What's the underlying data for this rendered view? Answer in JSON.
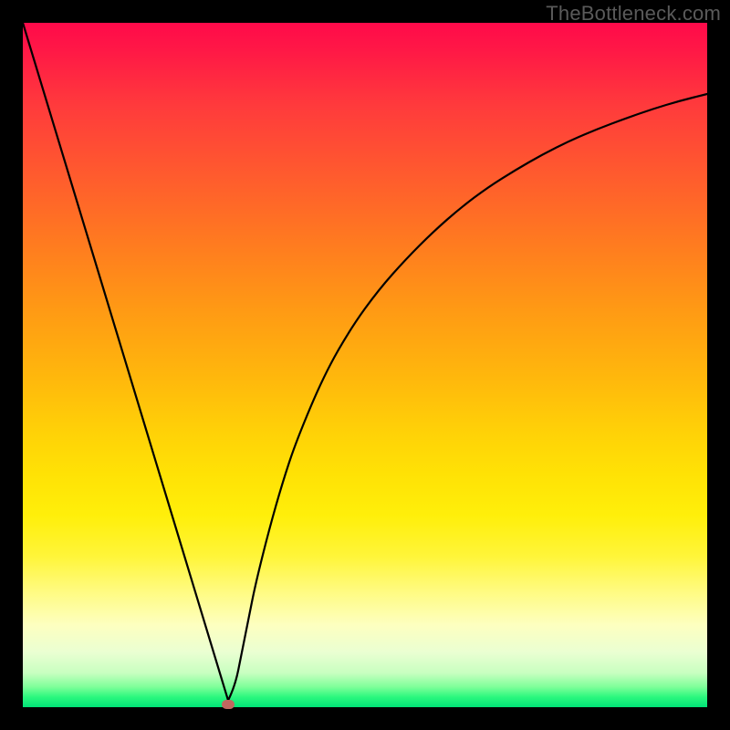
{
  "watermark": "TheBottleneck.com",
  "colors": {
    "frame": "#000000",
    "curve": "#000000",
    "marker": "#c1675f"
  },
  "chart_data": {
    "type": "line",
    "title": "",
    "xlabel": "",
    "ylabel": "",
    "xlim": [
      0,
      100
    ],
    "ylim": [
      0,
      100
    ],
    "grid": false,
    "legend": false,
    "series": [
      {
        "name": "bottleneck-curve",
        "x": [
          0,
          2,
          4,
          6,
          8,
          10,
          12,
          14,
          16,
          18,
          20,
          22,
          24,
          26,
          27,
          28,
          29,
          30,
          31,
          32,
          33,
          34,
          36,
          38,
          40,
          44,
          48,
          52,
          56,
          60,
          64,
          68,
          72,
          76,
          80,
          84,
          88,
          92,
          96,
          100
        ],
        "y": [
          100,
          93.4,
          86.8,
          80.2,
          73.6,
          67.0,
          60.4,
          53.8,
          47.2,
          40.6,
          34.0,
          27.4,
          20.8,
          14.2,
          10.9,
          7.6,
          4.3,
          1.0,
          3.0,
          8.0,
          13.0,
          18.0,
          26.0,
          33.0,
          39.0,
          48.5,
          55.5,
          61.0,
          65.5,
          69.5,
          73.0,
          76.0,
          78.5,
          80.8,
          82.8,
          84.5,
          86.0,
          87.4,
          88.6,
          89.6
        ]
      }
    ],
    "marker": {
      "x": 30,
      "y": 0.4
    },
    "background_gradient": {
      "top": "#ff0a4a",
      "upper_mid": "#ffb80c",
      "lower_mid": "#fffb80",
      "bottom": "#00e277"
    }
  }
}
